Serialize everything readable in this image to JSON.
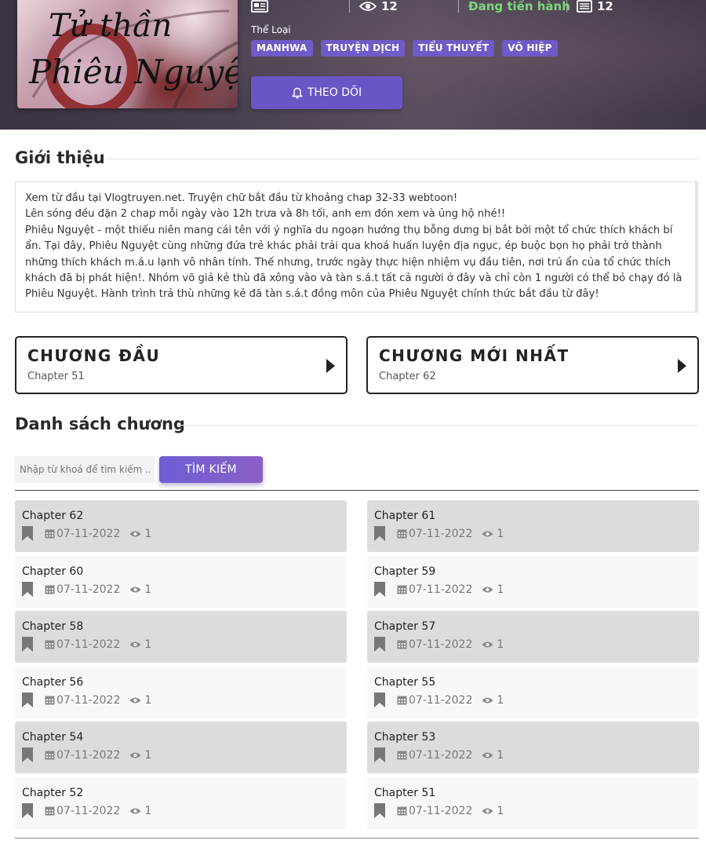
{
  "header": {
    "cover_title_line1": "Tử thần",
    "cover_title_line2": "Phiêu Nguyệt",
    "views": "12",
    "status": "Đang tiến hành",
    "chapter_count": "12",
    "genre_label": "Thể Loại",
    "genres": [
      "MANHWA",
      "TRUYỆN DỊCH",
      "TIỂU THUYẾT",
      "VÕ HIỆP"
    ],
    "follow_label": "THEO DÕI",
    "status_color": "#7dd77d",
    "accent_color": "#6b55c5"
  },
  "intro": {
    "title": "Giới thiệu",
    "lines": [
      "Xem từ đầu tại Vlogtruyen.net. Truyện chữ bắt đầu từ khoảng chap 32-33 webtoon!",
      "Lên sóng đều đặn 2 chap mỗi ngày vào 12h trưa và 8h tối, anh em đón xem và ủng hộ nhé!!",
      "Phiêu Nguyệt - một thiếu niên mang cái tên với ý nghĩa du ngoạn hướng thụ bỗng dưng bị bắt bởi một tổ chức thích khách bí ẩn. Tại đây, Phiêu Nguyệt cùng những đứa trẻ khác phải trải qua khoá huấn luyện địa ngục, ép buộc bọn họ phải trở thành những thích khách m.á.u lạnh vô nhân tính. Thế nhưng, trước ngày thực hiện nhiệm vụ đầu tiên, nơi trú ẩn của tổ chức thích khách đã bị phát hiện!. Nhóm võ giả kẻ thù đã xông vào và tàn s.á.t tất cả người ở đây và chỉ còn 1 người có thể bỏ chạy đó là Phiêu Nguyệt. Hành trình trả thù những kẻ đã tàn s.á.t đồng môn của Phiêu Nguyệt chính thức bắt đầu từ đây!"
    ]
  },
  "first_chapter": {
    "title": "CHƯƠNG ĐẦU",
    "chapter": "Chapter 51"
  },
  "latest_chapter": {
    "title": "CHƯƠNG MỚI NHẤT",
    "chapter": "Chapter 62"
  },
  "chapter_list": {
    "title": "Danh sách chương",
    "search_placeholder": "Nhập từ khoá để tìm kiếm ...",
    "search_button": "TÌM KIẾM",
    "items": [
      {
        "name": "Chapter 62",
        "date": "07-11-2022",
        "views": "1"
      },
      {
        "name": "Chapter 61",
        "date": "07-11-2022",
        "views": "1"
      },
      {
        "name": "Chapter 60",
        "date": "07-11-2022",
        "views": "1"
      },
      {
        "name": "Chapter 59",
        "date": "07-11-2022",
        "views": "1"
      },
      {
        "name": "Chapter 58",
        "date": "07-11-2022",
        "views": "1"
      },
      {
        "name": "Chapter 57",
        "date": "07-11-2022",
        "views": "1"
      },
      {
        "name": "Chapter 56",
        "date": "07-11-2022",
        "views": "1"
      },
      {
        "name": "Chapter 55",
        "date": "07-11-2022",
        "views": "1"
      },
      {
        "name": "Chapter 54",
        "date": "07-11-2022",
        "views": "1"
      },
      {
        "name": "Chapter 53",
        "date": "07-11-2022",
        "views": "1"
      },
      {
        "name": "Chapter 52",
        "date": "07-11-2022",
        "views": "1"
      },
      {
        "name": "Chapter 51",
        "date": "07-11-2022",
        "views": "1"
      }
    ]
  }
}
